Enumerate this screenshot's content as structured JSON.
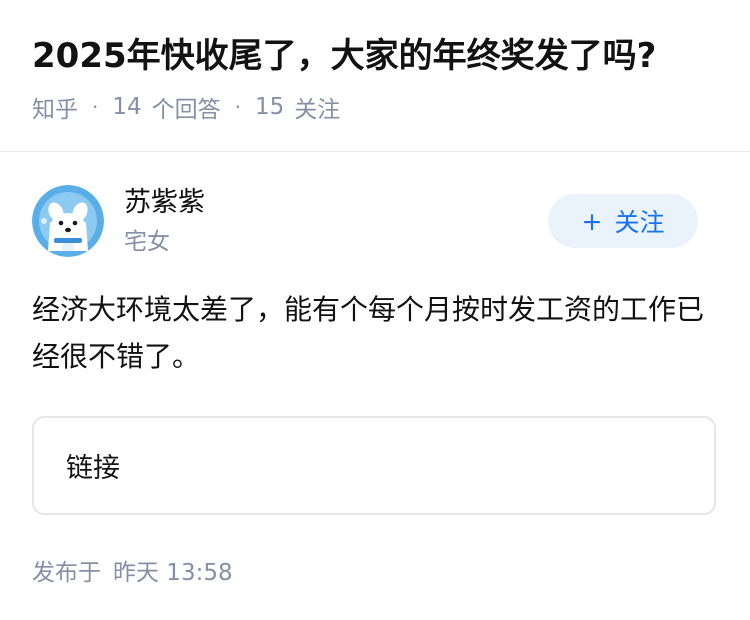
{
  "question": {
    "title": "2025年快收尾了，大家的年终奖发了吗?",
    "meta": {
      "source": "知乎",
      "answers_count": "14",
      "answers_label": "个回答",
      "followers_count": "15",
      "followers_label": "关注"
    }
  },
  "author": {
    "name": "苏紫紫",
    "tag": "宅女",
    "avatar_icon": "cartoon-dog-avatar-icon",
    "follow_button": {
      "icon": "+",
      "label": "关注"
    }
  },
  "answer": {
    "text": "经济大环境太差了，能有个每个月按时发工资的工作已经很不错了。"
  },
  "link_card": {
    "label": "链接"
  },
  "publish": {
    "prefix": "发布于",
    "time": "昨天 13:58"
  },
  "colors": {
    "meta_gray": "#8590a6",
    "brand_blue": "#1772f6",
    "follow_bg": "#eaf2fb"
  }
}
